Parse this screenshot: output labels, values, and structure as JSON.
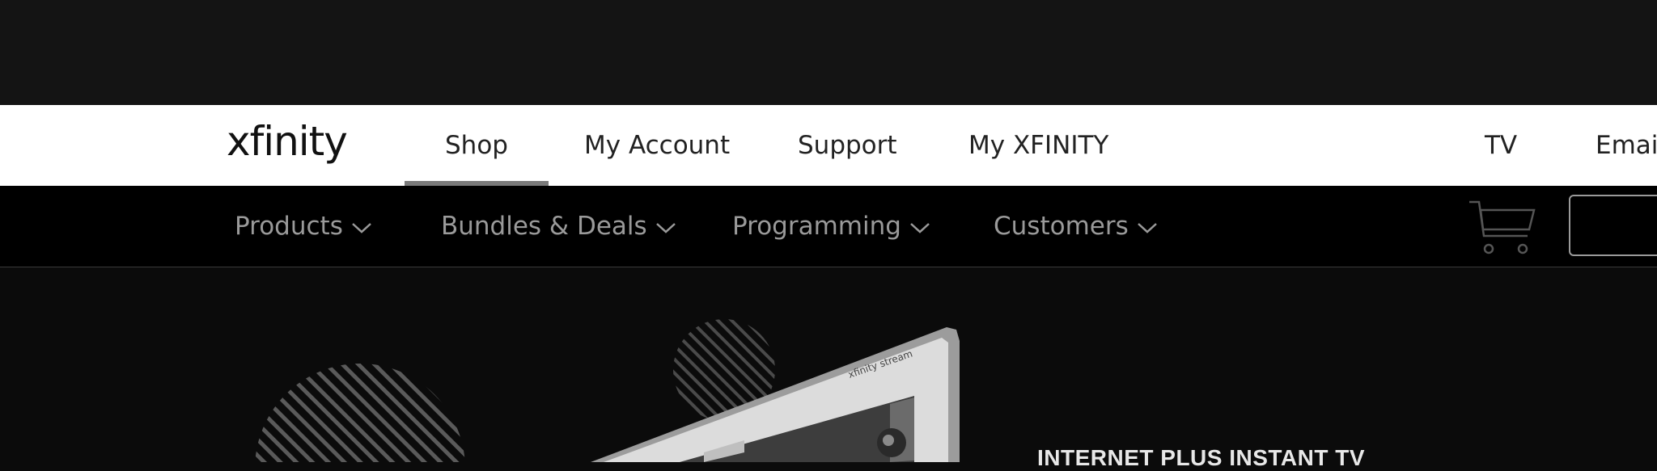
{
  "brand": {
    "logo_text": "xfinity"
  },
  "global_nav": {
    "items": [
      {
        "label": "Shop",
        "active": true
      },
      {
        "label": "My Account"
      },
      {
        "label": "Support"
      },
      {
        "label": "My XFINITY"
      },
      {
        "label": "TV"
      },
      {
        "label": "Email"
      }
    ]
  },
  "sub_nav": {
    "items": [
      {
        "label": "Products"
      },
      {
        "label": "Bundles & Deals"
      },
      {
        "label": "Programming"
      },
      {
        "label": "Customers"
      }
    ],
    "cart_icon": "shopping-cart-icon",
    "chevron_icon": "chevron-down-icon"
  },
  "hero": {
    "heading": "INTERNET PLUS INSTANT TV",
    "tablet_brand": "xfinity stream"
  },
  "colors": {
    "top_band": "#141414",
    "global_nav_bg": "#ffffff",
    "sub_nav_bg": "#000000",
    "hero_bg": "#0b0b0b",
    "active_indicator": "#7a7a7a"
  }
}
